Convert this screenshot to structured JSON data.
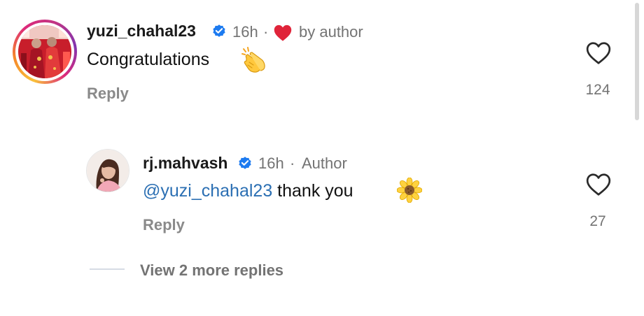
{
  "colors": {
    "heart_red": "#e0243a",
    "verified_blue": "#1d7bf0",
    "mention_blue": "#2b6fb3",
    "meta_gray": "#737373"
  },
  "comments": [
    {
      "username": "yuzi_chahal23",
      "verified": true,
      "time": "16h",
      "separator": "·",
      "liked_by_author_label": "by author",
      "text": "Congratulations",
      "emoji": "clapping-hands",
      "reply_label": "Reply",
      "like_count": "124"
    },
    {
      "username": "rj.mahvash",
      "verified": true,
      "time": "16h",
      "separator": "·",
      "author_label": "Author",
      "mention": "@yuzi_chahal23",
      "text": "thank you",
      "emoji": "sunflower",
      "reply_label": "Reply",
      "like_count": "27"
    }
  ],
  "view_more_label": "View 2 more replies",
  "icons": [
    "verified-badge-icon",
    "heart-filled-icon",
    "heart-outline-icon",
    "clapping-hands-emoji",
    "sunflower-emoji"
  ]
}
